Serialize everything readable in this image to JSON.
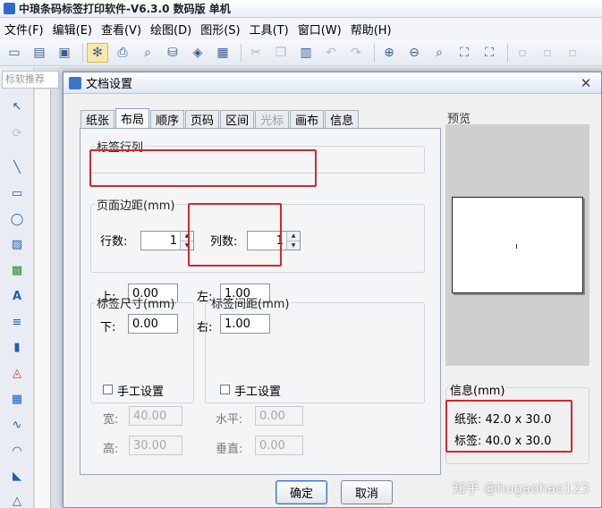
{
  "app": {
    "title": "中琅条码标签打印软件-V6.3.0 数码版 单机"
  },
  "menu": [
    "文件(F)",
    "编辑(E)",
    "查看(V)",
    "绘图(D)",
    "图形(S)",
    "工具(T)",
    "窗口(W)",
    "帮助(H)"
  ],
  "search": {
    "placeholder": "标软推荐"
  },
  "dialog": {
    "title": "文档设置",
    "close_glyph": "✕",
    "tabs": [
      {
        "label": "纸张",
        "state": "normal"
      },
      {
        "label": "布局",
        "state": "active"
      },
      {
        "label": "顺序",
        "state": "normal"
      },
      {
        "label": "页码",
        "state": "normal"
      },
      {
        "label": "区间",
        "state": "normal"
      },
      {
        "label": "光标",
        "state": "disabled"
      },
      {
        "label": "画布",
        "state": "normal"
      },
      {
        "label": "信息",
        "state": "normal"
      }
    ],
    "rows_cols": {
      "legend": "标签行列",
      "rows_label": "行数:",
      "rows_value": "1",
      "cols_label": "列数:",
      "cols_value": "1"
    },
    "margins": {
      "legend": "页面边距(mm)",
      "top_label": "上:",
      "top_value": "0.00",
      "bottom_label": "下:",
      "bottom_value": "0.00",
      "left_label": "左:",
      "left_value": "1.00",
      "right_label": "右:",
      "right_value": "1.00"
    },
    "label_size": {
      "legend": "标签尺寸(mm)",
      "manual_label": "手工设置",
      "manual_checked": false,
      "width_label": "宽:",
      "width_value": "40.00",
      "height_label": "高:",
      "height_value": "30.00"
    },
    "label_spacing": {
      "legend": "标签间距(mm)",
      "manual_label": "手工设置",
      "manual_checked": false,
      "horizontal_label": "水平:",
      "horizontal_value": "0.00",
      "vertical_label": "垂直:",
      "vertical_value": "0.00"
    },
    "preview": {
      "label": "预览"
    },
    "info": {
      "legend": "信息(mm)",
      "paper_line": "纸张: 42.0 x 30.0",
      "label_line": "标签: 40.0 x 30.0"
    },
    "ok_label": "确定",
    "cancel_label": "取消"
  },
  "watermark": "知乎 @hugaohao123",
  "colors": {
    "highlight_box": "#d8262c",
    "primary_border": "#3a73c4"
  }
}
